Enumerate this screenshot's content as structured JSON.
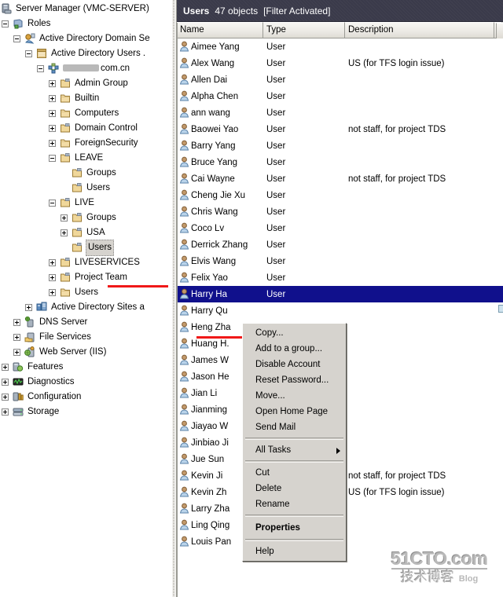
{
  "colors": {
    "title_bar_bg": "#3a3a4a",
    "selection_blue": "#10108c",
    "annotation_red": "#f01818",
    "menu_bg": "#d6d3ce",
    "header_bg": "#e8e6e1"
  },
  "tree": {
    "items": [
      {
        "label": "Server Manager (VMC-SERVER)",
        "indent": 0,
        "expander": "none",
        "icon": "server-manager-icon"
      },
      {
        "label": "Roles",
        "indent": 1,
        "expander": "minus",
        "icon": "roles-icon"
      },
      {
        "label": "Active Directory Domain Se",
        "indent": 2,
        "expander": "minus",
        "icon": "ad-domain-services-icon"
      },
      {
        "label": "Active Directory Users .",
        "indent": 3,
        "expander": "minus",
        "icon": "ad-users-snapin-icon"
      },
      {
        "label": "com.cn",
        "indent": 4,
        "expander": "minus",
        "icon": "domain-icon",
        "redacted": true
      },
      {
        "label": "Admin Group",
        "indent": 5,
        "expander": "plus",
        "icon": "ou-icon"
      },
      {
        "label": "Builtin",
        "indent": 5,
        "expander": "plus",
        "icon": "folder-icon"
      },
      {
        "label": "Computers",
        "indent": 5,
        "expander": "plus",
        "icon": "folder-icon"
      },
      {
        "label": "Domain Control",
        "indent": 5,
        "expander": "plus",
        "icon": "ou-icon"
      },
      {
        "label": "ForeignSecurity",
        "indent": 5,
        "expander": "plus",
        "icon": "folder-icon"
      },
      {
        "label": "LEAVE",
        "indent": 5,
        "expander": "minus",
        "icon": "ou-icon"
      },
      {
        "label": "Groups",
        "indent": 6,
        "expander": "none",
        "icon": "ou-icon"
      },
      {
        "label": "Users",
        "indent": 6,
        "expander": "none",
        "icon": "ou-icon"
      },
      {
        "label": "LIVE",
        "indent": 5,
        "expander": "minus",
        "icon": "ou-icon"
      },
      {
        "label": "Groups",
        "indent": 6,
        "expander": "plus",
        "icon": "ou-icon"
      },
      {
        "label": "USA",
        "indent": 6,
        "expander": "plus",
        "icon": "ou-icon"
      },
      {
        "label": "Users",
        "indent": 6,
        "expander": "none",
        "icon": "ou-icon",
        "selected": true
      },
      {
        "label": "LIVESERVICES",
        "indent": 5,
        "expander": "plus",
        "icon": "ou-icon"
      },
      {
        "label": "Project Team",
        "indent": 5,
        "expander": "plus",
        "icon": "ou-icon"
      },
      {
        "label": "Users",
        "indent": 5,
        "expander": "plus",
        "icon": "folder-icon"
      },
      {
        "label": "Active Directory Sites a",
        "indent": 3,
        "expander": "plus",
        "icon": "ad-sites-icon"
      },
      {
        "label": "DNS Server",
        "indent": 2,
        "expander": "plus",
        "icon": "dns-server-icon"
      },
      {
        "label": "File Services",
        "indent": 2,
        "expander": "plus",
        "icon": "file-services-icon"
      },
      {
        "label": "Web Server (IIS)",
        "indent": 2,
        "expander": "plus",
        "icon": "web-server-icon"
      },
      {
        "label": "Features",
        "indent": 1,
        "expander": "plus",
        "icon": "features-icon"
      },
      {
        "label": "Diagnostics",
        "indent": 1,
        "expander": "plus",
        "icon": "diagnostics-icon"
      },
      {
        "label": "Configuration",
        "indent": 1,
        "expander": "plus",
        "icon": "configuration-icon"
      },
      {
        "label": "Storage",
        "indent": 1,
        "expander": "plus",
        "icon": "storage-icon"
      }
    ]
  },
  "list": {
    "title": "Users",
    "count": "47 objects",
    "filter": "[Filter Activated]",
    "columns": [
      "Name",
      "Type",
      "Description"
    ],
    "rows": [
      {
        "name": "Aimee Yang",
        "type": "User",
        "description": ""
      },
      {
        "name": "Alex Wang",
        "type": "User",
        "description": "US (for TFS login issue)"
      },
      {
        "name": "Allen Dai",
        "type": "User",
        "description": ""
      },
      {
        "name": "Alpha Chen",
        "type": "User",
        "description": ""
      },
      {
        "name": "ann wang",
        "type": "User",
        "description": ""
      },
      {
        "name": "Baowei Yao",
        "type": "User",
        "description": "not staff, for project TDS"
      },
      {
        "name": "Barry Yang",
        "type": "User",
        "description": ""
      },
      {
        "name": "Bruce Yang",
        "type": "User",
        "description": ""
      },
      {
        "name": "Cai Wayne",
        "type": "User",
        "description": "not staff, for project TDS"
      },
      {
        "name": "Cheng Jie Xu",
        "type": "User",
        "description": ""
      },
      {
        "name": "Chris Wang",
        "type": "User",
        "description": ""
      },
      {
        "name": "Coco Lv",
        "type": "User",
        "description": ""
      },
      {
        "name": "Derrick Zhang",
        "type": "User",
        "description": ""
      },
      {
        "name": "Elvis Wang",
        "type": "User",
        "description": ""
      },
      {
        "name": "Felix Yao",
        "type": "User",
        "description": ""
      },
      {
        "name": "Harry Ha",
        "type": "User",
        "description": "",
        "selected": true
      },
      {
        "name": "Harry Qu",
        "type": "",
        "description": ""
      },
      {
        "name": "Heng Zha",
        "type": "",
        "description": ""
      },
      {
        "name": "Huang H.",
        "type": "",
        "description": ""
      },
      {
        "name": "James W",
        "type": "",
        "description": ""
      },
      {
        "name": "Jason He",
        "type": "",
        "description": ""
      },
      {
        "name": "Jian Li",
        "type": "",
        "description": ""
      },
      {
        "name": "Jianming",
        "type": "",
        "description": ""
      },
      {
        "name": "Jiayao W",
        "type": "",
        "description": ""
      },
      {
        "name": "Jinbiao Ji",
        "type": "",
        "description": ""
      },
      {
        "name": "Jue Sun",
        "type": "",
        "description": ""
      },
      {
        "name": "Kevin Ji",
        "type": "",
        "description": "not staff, for project TDS"
      },
      {
        "name": "Kevin Zh",
        "type": "",
        "description": "US (for TFS login issue)"
      },
      {
        "name": "Larry Zha",
        "type": "",
        "description": ""
      },
      {
        "name": "Ling Qing",
        "type": "",
        "description": ""
      },
      {
        "name": "Louis Pan",
        "type": "",
        "description": ""
      }
    ]
  },
  "context_menu": {
    "items": [
      {
        "label": "Copy...",
        "kind": "item"
      },
      {
        "label": "Add to a group...",
        "kind": "item"
      },
      {
        "label": "Disable Account",
        "kind": "item"
      },
      {
        "label": "Reset Password...",
        "kind": "item"
      },
      {
        "label": "Move...",
        "kind": "item"
      },
      {
        "label": "Open Home Page",
        "kind": "item"
      },
      {
        "label": "Send Mail",
        "kind": "item"
      },
      {
        "kind": "separator"
      },
      {
        "label": "All Tasks",
        "kind": "submenu"
      },
      {
        "kind": "separator"
      },
      {
        "label": "Cut",
        "kind": "item"
      },
      {
        "label": "Delete",
        "kind": "item"
      },
      {
        "label": "Rename",
        "kind": "item"
      },
      {
        "kind": "separator"
      },
      {
        "label": "Properties",
        "kind": "item",
        "bold": true
      },
      {
        "kind": "separator"
      },
      {
        "label": "Help",
        "kind": "item"
      }
    ]
  },
  "watermark": {
    "top": "51CTO.com",
    "bottom_cn": "技术博客",
    "bottom_en": "Blog"
  }
}
